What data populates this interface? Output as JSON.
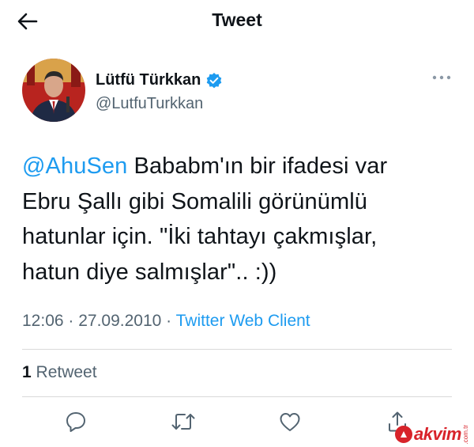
{
  "header": {
    "title": "Tweet"
  },
  "author": {
    "display_name": "Lütfü Türkkan",
    "handle": "@LutfuTurkkan",
    "verified": true
  },
  "tweet": {
    "mention": "@AhuSen",
    "line1_rest": " Bababm'ın bir ifadesi var",
    "line2": "Ebru Şallı gibi Somalili görünümlü",
    "line3": "hatunlar için. \"İki tahtayı çakmışlar,",
    "line4": "hatun diye salmışlar\".. :))"
  },
  "meta": {
    "time": "12:06",
    "separator1": " · ",
    "date": "27.09.2010",
    "separator2": " · ",
    "source": "Twitter Web Client"
  },
  "stats": {
    "retweet_count": "1",
    "retweet_label": "Retweet"
  },
  "actions": {
    "icons": [
      "reply-icon",
      "retweet-icon",
      "like-icon",
      "share-icon"
    ]
  },
  "watermark": {
    "brand": "akvim",
    "tld": ".com.tr"
  },
  "colors": {
    "accent": "#1d9bf0",
    "text": "#0f1419",
    "secondary": "#536471",
    "watermark": "#d8232a"
  }
}
